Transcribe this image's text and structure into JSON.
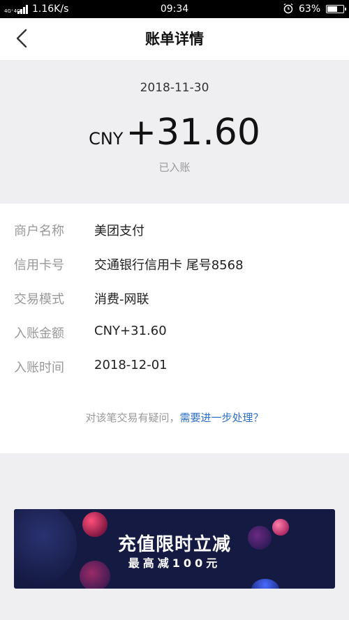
{
  "status_bar": {
    "network": "4G⁺4G",
    "speed": "1.16K/s",
    "time": "09:34",
    "battery": "63%"
  },
  "nav": {
    "title": "账单详情"
  },
  "summary": {
    "date": "2018-11-30",
    "currency": "CNY",
    "amount": "+31.60",
    "status": "已入账"
  },
  "details": [
    {
      "label": "商户名称",
      "value": "美团支付"
    },
    {
      "label": "信用卡号",
      "value": "交通银行信用卡 尾号8568"
    },
    {
      "label": "交易模式",
      "value": "消费-网联"
    },
    {
      "label": "入账金额",
      "value": "CNY+31.60"
    },
    {
      "label": "入账时间",
      "value": "2018-12-01"
    }
  ],
  "query": {
    "prefix": "对该笔交易有疑问，",
    "link": "需要进一步处理？"
  },
  "banner": {
    "headline": "充值限时立减",
    "subtitle": "最高减100元"
  },
  "colors": {
    "link": "#2d6fc6",
    "banner_bg": "#141a42"
  }
}
